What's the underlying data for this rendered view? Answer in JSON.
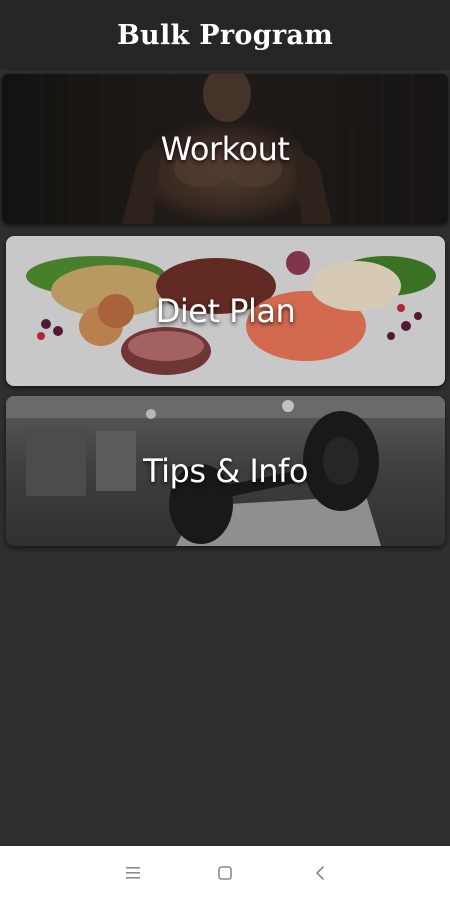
{
  "app_bar": {
    "title": "Bulk Program"
  },
  "menu": {
    "workout_label": "Workout",
    "diet_plan_label": "Diet Plan",
    "tips_info_label": "Tips & Info"
  },
  "system_nav": {
    "menu_icon": "menu-lines-icon",
    "home_icon": "square-home-icon",
    "back_icon": "chevron-left-icon"
  },
  "colors": {
    "app_bar_bg": "#262626",
    "content_bg": "#2f2f2f",
    "nav_bar_bg": "#ffffff",
    "text": "#ffffff"
  }
}
